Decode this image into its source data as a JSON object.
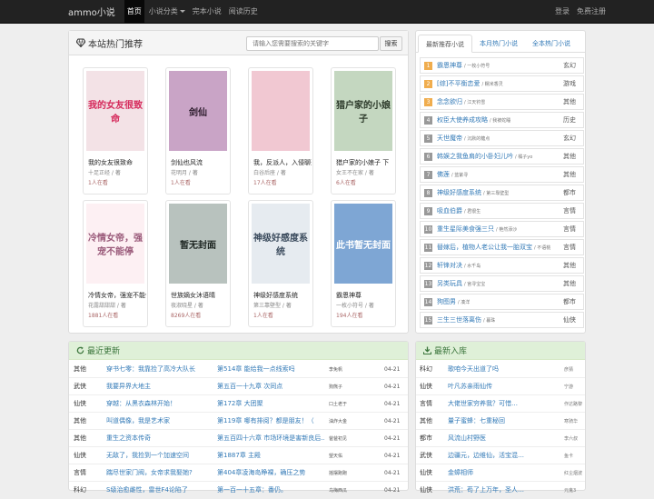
{
  "nav": {
    "brand": "ammo小说",
    "items": [
      "首页",
      "小说分类",
      "完本小说",
      "阅读历史"
    ],
    "login": "登录",
    "register": "免费注册"
  },
  "hot": {
    "title": "本站热门推荐",
    "search_placeholder": "请输入您需要搜索的关键字",
    "search_button": "搜索",
    "books": [
      {
        "title": "我的女友很致命",
        "author": "十足正经 / 著",
        "readers": "1人在看",
        "cover_text": "我的女友很致命",
        "cover_bg": "#f3e2e6",
        "cover_fg": "#d5285a"
      },
      {
        "title": "剑仙也风流",
        "author": "花明月 / 著",
        "readers": "1人在看",
        "cover_text": "剑仙",
        "cover_bg": "#c9a4c6",
        "cover_fg": "#2a1a2a"
      },
      {
        "title": "我，反派人，入侵聊天",
        "author": "白谷后座 / 著",
        "readers": "17人在看",
        "cover_text": "",
        "cover_bg": "#f1c8d2",
        "cover_fg": "#ffffff"
      },
      {
        "title": "猎户家的小娘子 下",
        "author": "女王不在家 / 著",
        "readers": "6人在看",
        "cover_text": "猎户家的小娘子",
        "cover_bg": "#c4d7c0",
        "cover_fg": "#2c3a2a"
      },
      {
        "title": "冷情女帝，强宠不能停",
        "author": "花露甜甜甜 / 著",
        "readers": "1881人在看",
        "cover_text": "冷情女帝，强宠不能停",
        "cover_bg": "#fdf0f3",
        "cover_fg": "#9a5a7a"
      },
      {
        "title": "世族嫡女沐语晴",
        "author": "夜淑晓星 / 著",
        "readers": "8269人在看",
        "cover_text": "暂无封面",
        "cover_bg": "#b8c2be",
        "cover_fg": "#1e2622"
      },
      {
        "title": "神级好感度系统",
        "author": "第三靠壁型 / 著",
        "readers": "1人在看",
        "cover_text": "神级好感度系统",
        "cover_bg": "#e6ebf0",
        "cover_fg": "#3a4a5c"
      },
      {
        "title": "霸恩神尊",
        "author": "一枚小符号 / 著",
        "readers": "194人在看",
        "cover_text": "此书暂无封面",
        "cover_bg": "#7ea6d4",
        "cover_fg": "#ffffff"
      }
    ]
  },
  "rank": {
    "tabs": [
      "最新推荐小说",
      "本月热门小说",
      "全本热门小说"
    ],
    "items": [
      {
        "num": "1",
        "title": "霸恩神尊",
        "author": "/ 一枚小符号",
        "cat": "玄幻"
      },
      {
        "num": "2",
        "title": "[综]不平衡恋爱",
        "author": "/ 糯米香灵",
        "cat": "游戏"
      },
      {
        "num": "3",
        "title": "念念欲归",
        "author": "/ 江天钓雪",
        "cat": "其他"
      },
      {
        "num": "4",
        "title": "权臣大使养成攻略",
        "author": "/ 我被蛇睡",
        "cat": "历史"
      },
      {
        "num": "5",
        "title": "天世魔帝",
        "author": "/ 沉默的糖点",
        "cat": "玄幻"
      },
      {
        "num": "6",
        "title": "韩娱之我鱼肩的小卧妇儿吟",
        "author": "/ 橘子yo",
        "cat": "其他"
      },
      {
        "num": "7",
        "title": "佛莲",
        "author": "/ 蓝紫寻",
        "cat": "其他"
      },
      {
        "num": "8",
        "title": "神级好感度系统",
        "author": "/ 第三靠壁型",
        "cat": "都市"
      },
      {
        "num": "9",
        "title": "吸血伯爵",
        "author": "/ 君很生",
        "cat": "言情"
      },
      {
        "num": "10",
        "title": "重生星际美食强三只",
        "author": "/ 艳然添沙",
        "cat": "言情"
      },
      {
        "num": "11",
        "title": "替嫁后，植物人老公让我一胎双宝",
        "author": "/ 不语桃",
        "cat": "言情"
      },
      {
        "num": "12",
        "title": "轩锋对决",
        "author": "/ 水千岛",
        "cat": "其他"
      },
      {
        "num": "13",
        "title": "另类玩具",
        "author": "/ 宫寻宝宝",
        "cat": "其他"
      },
      {
        "num": "14",
        "title": "狗图男",
        "author": "/ 凑洋",
        "cat": "都市"
      },
      {
        "num": "15",
        "title": "三生三世落离伤",
        "author": "/ 暮珠",
        "cat": "仙侠"
      }
    ]
  },
  "updates": {
    "title": "最近更新",
    "rows": [
      {
        "cat": "其他",
        "book": "穿书七零：我靠捡了高冷大队长",
        "chapter": "第514章 能给我一点线索吗",
        "author": "李免帆",
        "date": "04-21"
      },
      {
        "cat": "武侠",
        "book": "我要异界大地主",
        "chapter": "第五百一十九章 次同点",
        "author": "狗熊子",
        "date": "04-21"
      },
      {
        "cat": "仙侠",
        "book": "穿越：从黑衣森林开始！",
        "chapter": "第172章 大团聚",
        "author": "口土老于",
        "date": "04-21"
      },
      {
        "cat": "其他",
        "book": "叫道偶像，我是艺术家",
        "chapter": "第119章 哪有排阅？都是朋友！（",
        "author": "油炸大金",
        "date": "04-21"
      },
      {
        "cat": "其他",
        "book": "重生之资本传奇",
        "chapter": "第五百四十六章 市场环境是害新良后…",
        "author": "爸爸初见",
        "date": "04-21"
      },
      {
        "cat": "仙侠",
        "book": "无敌了，我捡到一个加速空间",
        "chapter": "第1887章 主殿",
        "author": "望天佑",
        "date": "04-21"
      },
      {
        "cat": "言情",
        "book": "踹尽世家门阀，女帝求我娶她?",
        "chapter": "第404章凌海岛睁裸，确压之势",
        "author": "摇摆跑跑",
        "date": "04-21"
      },
      {
        "cat": "科幻",
        "book": "S级治愈雌性，雷世F4论陷了",
        "chapter": "第一百一十五章：番仍。",
        "author": "乌梅西瓜",
        "date": "04-21"
      }
    ]
  },
  "newbooks": {
    "title": "最新入库",
    "rows": [
      {
        "cat": "科幻",
        "book": "歌咱今天出道了吗",
        "author": "彦猜"
      },
      {
        "cat": "仙侠",
        "book": "叶凡苏亲雨仙传",
        "author": "宁游"
      },
      {
        "cat": "言情",
        "book": "大佬世家穷养我？可惜…",
        "author": "作达路黎"
      },
      {
        "cat": "其他",
        "book": "量子蜜蜂：七重秘回",
        "author": "寒骑华"
      },
      {
        "cat": "都市",
        "book": "风流山村野医",
        "author": "李六叔"
      },
      {
        "cat": "武侠",
        "book": "边疆元，边维仙，活宝混…",
        "author": "鱼卡"
      },
      {
        "cat": "仙侠",
        "book": "金蟑相师",
        "author": "红尘烟波"
      },
      {
        "cat": "仙侠",
        "book": "洪荒：苟了上万年，圣人…",
        "author": "元鬼3"
      }
    ]
  }
}
